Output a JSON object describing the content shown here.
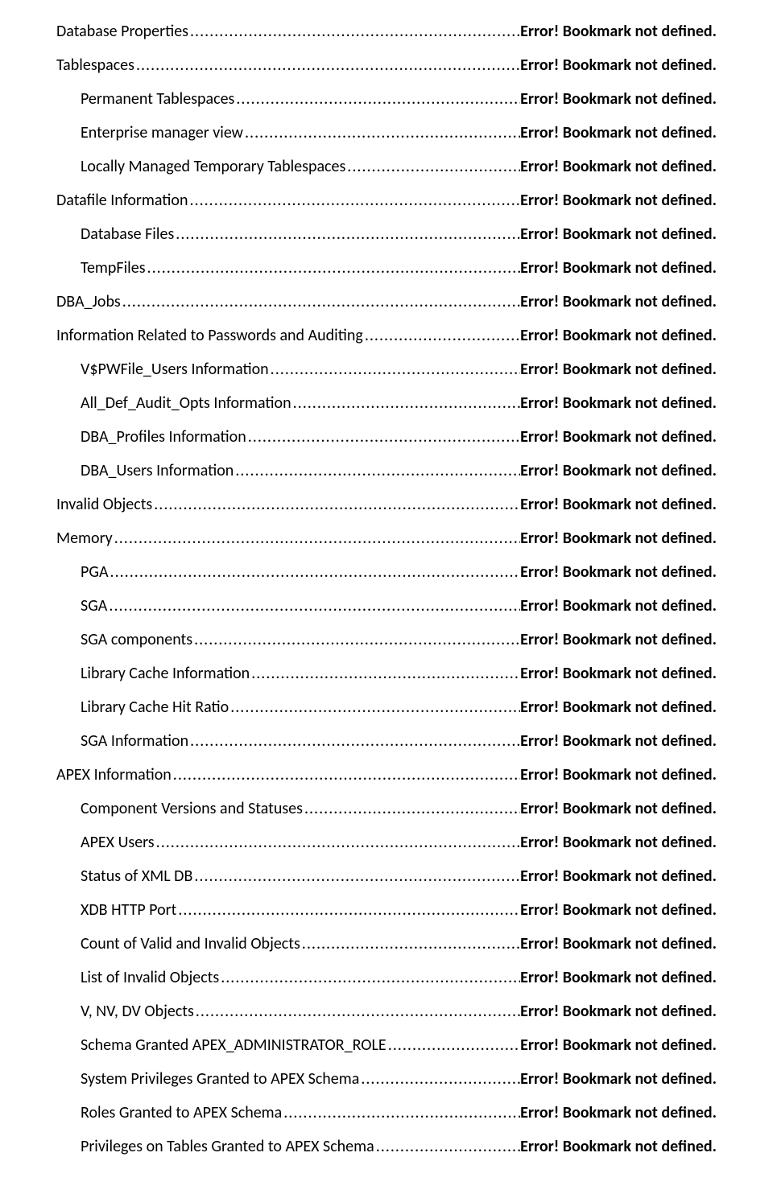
{
  "status_text": "Error! Bookmark not defined.",
  "dots": "........................................................................................................................................................................................................................................",
  "entries": [
    {
      "title": "Database Properties",
      "level": 0
    },
    {
      "title": "Tablespaces",
      "level": 0
    },
    {
      "title": "Permanent Tablespaces",
      "level": 1
    },
    {
      "title": "Enterprise manager view",
      "level": 1
    },
    {
      "title": "Locally Managed Temporary Tablespaces",
      "level": 1
    },
    {
      "title": "Datafile Information",
      "level": 0
    },
    {
      "title": "Database Files",
      "level": 1
    },
    {
      "title": "TempFiles",
      "level": 1
    },
    {
      "title": "DBA_Jobs",
      "level": 0
    },
    {
      "title": "Information Related to Passwords and Auditing",
      "level": 0
    },
    {
      "title": "V$PWFile_Users Information",
      "level": 1
    },
    {
      "title": "All_Def_Audit_Opts Information",
      "level": 1
    },
    {
      "title": "DBA_Profiles Information",
      "level": 1
    },
    {
      "title": "DBA_Users Information",
      "level": 1
    },
    {
      "title": "Invalid Objects",
      "level": 0
    },
    {
      "title": "Memory",
      "level": 0
    },
    {
      "title": "PGA",
      "level": 1
    },
    {
      "title": "SGA",
      "level": 1
    },
    {
      "title": "SGA components",
      "level": 1
    },
    {
      "title": "Library Cache Information",
      "level": 1
    },
    {
      "title": "Library Cache Hit Ratio",
      "level": 1
    },
    {
      "title": "SGA Information",
      "level": 1
    },
    {
      "title": "APEX Information",
      "level": 0
    },
    {
      "title": "Component Versions and Statuses",
      "level": 1
    },
    {
      "title": "APEX Users",
      "level": 1
    },
    {
      "title": "Status of XML DB",
      "level": 1
    },
    {
      "title": "XDB HTTP Port",
      "level": 1
    },
    {
      "title": "Count of Valid and Invalid Objects",
      "level": 1
    },
    {
      "title": "List of Invalid Objects",
      "level": 1
    },
    {
      "title": "V, NV, DV Objects",
      "level": 1
    },
    {
      "title": "Schema Granted APEX_ADMINISTRATOR_ROLE",
      "level": 1
    },
    {
      "title": "System Privileges Granted to APEX Schema",
      "level": 1
    },
    {
      "title": "Roles Granted to APEX Schema",
      "level": 1
    },
    {
      "title": "Privileges on Tables Granted to APEX Schema",
      "level": 1
    }
  ]
}
